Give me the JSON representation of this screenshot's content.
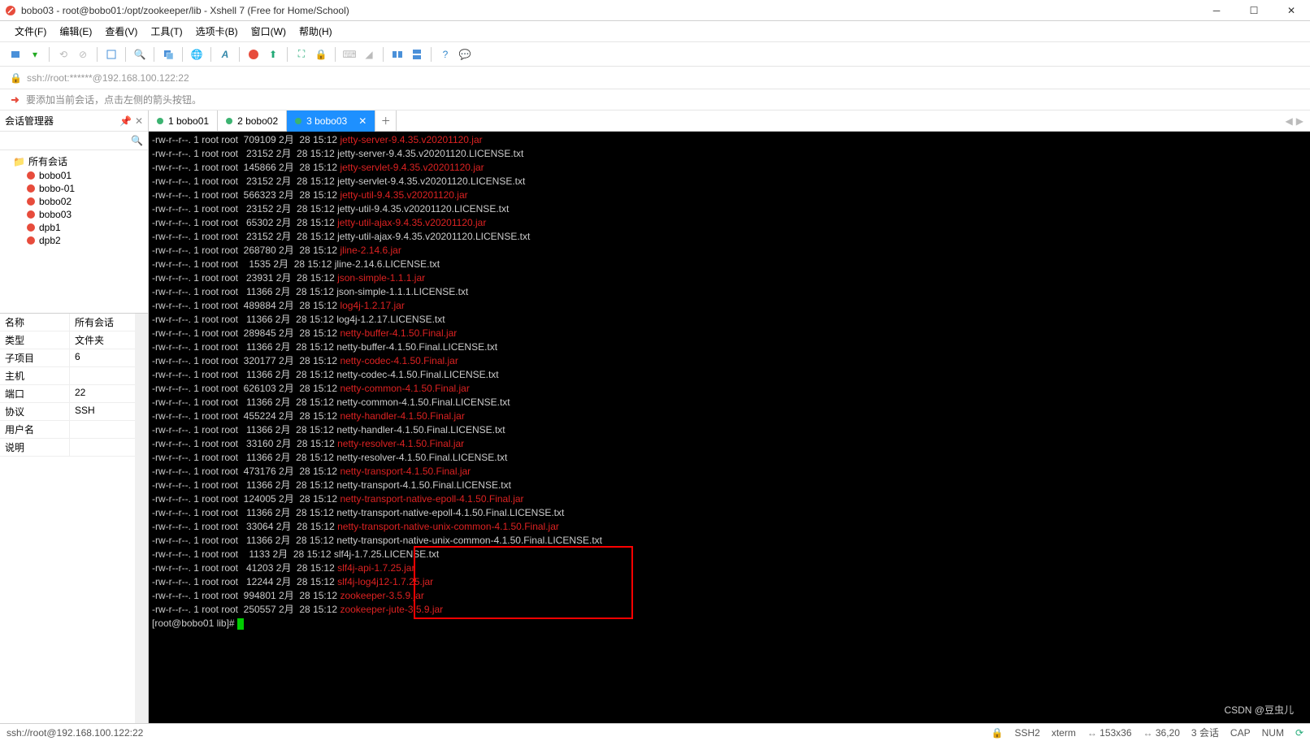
{
  "title": "bobo03 - root@bobo01:/opt/zookeeper/lib - Xshell 7 (Free for Home/School)",
  "menu": [
    "文件(F)",
    "编辑(E)",
    "查看(V)",
    "工具(T)",
    "选项卡(B)",
    "窗口(W)",
    "帮助(H)"
  ],
  "addr": "ssh://root:******@192.168.100.122:22",
  "hint": "要添加当前会话，点击左侧的箭头按钮。",
  "side_title": "会话管理器",
  "tree_root": "所有会话",
  "tree_items": [
    "bobo01",
    "bobo-01",
    "bobo02",
    "bobo03",
    "dpb1",
    "dpb2"
  ],
  "props": [
    {
      "k": "名称",
      "v": "所有会话"
    },
    {
      "k": "类型",
      "v": "文件夹"
    },
    {
      "k": "子项目",
      "v": "6"
    },
    {
      "k": "主机",
      "v": ""
    },
    {
      "k": "端口",
      "v": "22"
    },
    {
      "k": "协议",
      "v": "SSH"
    },
    {
      "k": "用户名",
      "v": ""
    },
    {
      "k": "说明",
      "v": ""
    }
  ],
  "tabs": [
    {
      "n": "1",
      "label": "bobo01",
      "active": false
    },
    {
      "n": "2",
      "label": "bobo02",
      "active": false
    },
    {
      "n": "3",
      "label": "bobo03",
      "active": true
    }
  ],
  "lines": [
    {
      "pre": "-rw-r--r--. 1 root root  709109 2月  28 15:12 ",
      "fn": "jetty-server-9.4.35.v20201120.jar",
      "c": "r"
    },
    {
      "pre": "-rw-r--r--. 1 root root   23152 2月  28 15:12 ",
      "fn": "jetty-server-9.4.35.v20201120.LICENSE.txt",
      "c": "w"
    },
    {
      "pre": "-rw-r--r--. 1 root root  145866 2月  28 15:12 ",
      "fn": "jetty-servlet-9.4.35.v20201120.jar",
      "c": "r"
    },
    {
      "pre": "-rw-r--r--. 1 root root   23152 2月  28 15:12 ",
      "fn": "jetty-servlet-9.4.35.v20201120.LICENSE.txt",
      "c": "w"
    },
    {
      "pre": "-rw-r--r--. 1 root root  566323 2月  28 15:12 ",
      "fn": "jetty-util-9.4.35.v20201120.jar",
      "c": "r"
    },
    {
      "pre": "-rw-r--r--. 1 root root   23152 2月  28 15:12 ",
      "fn": "jetty-util-9.4.35.v20201120.LICENSE.txt",
      "c": "w"
    },
    {
      "pre": "-rw-r--r--. 1 root root   65302 2月  28 15:12 ",
      "fn": "jetty-util-ajax-9.4.35.v20201120.jar",
      "c": "r"
    },
    {
      "pre": "-rw-r--r--. 1 root root   23152 2月  28 15:12 ",
      "fn": "jetty-util-ajax-9.4.35.v20201120.LICENSE.txt",
      "c": "w"
    },
    {
      "pre": "-rw-r--r--. 1 root root  268780 2月  28 15:12 ",
      "fn": "jline-2.14.6.jar",
      "c": "r"
    },
    {
      "pre": "-rw-r--r--. 1 root root    1535 2月  28 15:12 ",
      "fn": "jline-2.14.6.LICENSE.txt",
      "c": "w"
    },
    {
      "pre": "-rw-r--r--. 1 root root   23931 2月  28 15:12 ",
      "fn": "json-simple-1.1.1.jar",
      "c": "r"
    },
    {
      "pre": "-rw-r--r--. 1 root root   11366 2月  28 15:12 ",
      "fn": "json-simple-1.1.1.LICENSE.txt",
      "c": "w"
    },
    {
      "pre": "-rw-r--r--. 1 root root  489884 2月  28 15:12 ",
      "fn": "log4j-1.2.17.jar",
      "c": "r"
    },
    {
      "pre": "-rw-r--r--. 1 root root   11366 2月  28 15:12 ",
      "fn": "log4j-1.2.17.LICENSE.txt",
      "c": "w"
    },
    {
      "pre": "-rw-r--r--. 1 root root  289845 2月  28 15:12 ",
      "fn": "netty-buffer-4.1.50.Final.jar",
      "c": "r"
    },
    {
      "pre": "-rw-r--r--. 1 root root   11366 2月  28 15:12 ",
      "fn": "netty-buffer-4.1.50.Final.LICENSE.txt",
      "c": "w"
    },
    {
      "pre": "-rw-r--r--. 1 root root  320177 2月  28 15:12 ",
      "fn": "netty-codec-4.1.50.Final.jar",
      "c": "r"
    },
    {
      "pre": "-rw-r--r--. 1 root root   11366 2月  28 15:12 ",
      "fn": "netty-codec-4.1.50.Final.LICENSE.txt",
      "c": "w"
    },
    {
      "pre": "-rw-r--r--. 1 root root  626103 2月  28 15:12 ",
      "fn": "netty-common-4.1.50.Final.jar",
      "c": "r"
    },
    {
      "pre": "-rw-r--r--. 1 root root   11366 2月  28 15:12 ",
      "fn": "netty-common-4.1.50.Final.LICENSE.txt",
      "c": "w"
    },
    {
      "pre": "-rw-r--r--. 1 root root  455224 2月  28 15:12 ",
      "fn": "netty-handler-4.1.50.Final.jar",
      "c": "r"
    },
    {
      "pre": "-rw-r--r--. 1 root root   11366 2月  28 15:12 ",
      "fn": "netty-handler-4.1.50.Final.LICENSE.txt",
      "c": "w"
    },
    {
      "pre": "-rw-r--r--. 1 root root   33160 2月  28 15:12 ",
      "fn": "netty-resolver-4.1.50.Final.jar",
      "c": "r"
    },
    {
      "pre": "-rw-r--r--. 1 root root   11366 2月  28 15:12 ",
      "fn": "netty-resolver-4.1.50.Final.LICENSE.txt",
      "c": "w"
    },
    {
      "pre": "-rw-r--r--. 1 root root  473176 2月  28 15:12 ",
      "fn": "netty-transport-4.1.50.Final.jar",
      "c": "r"
    },
    {
      "pre": "-rw-r--r--. 1 root root   11366 2月  28 15:12 ",
      "fn": "netty-transport-4.1.50.Final.LICENSE.txt",
      "c": "w"
    },
    {
      "pre": "-rw-r--r--. 1 root root  124005 2月  28 15:12 ",
      "fn": "netty-transport-native-epoll-4.1.50.Final.jar",
      "c": "r"
    },
    {
      "pre": "-rw-r--r--. 1 root root   11366 2月  28 15:12 ",
      "fn": "netty-transport-native-epoll-4.1.50.Final.LICENSE.txt",
      "c": "w"
    },
    {
      "pre": "-rw-r--r--. 1 root root   33064 2月  28 15:12 ",
      "fn": "netty-transport-native-unix-common-4.1.50.Final.jar",
      "c": "r"
    },
    {
      "pre": "-rw-r--r--. 1 root root   11366 2月  28 15:12 ",
      "fn": "netty-transport-native-unix-common-4.1.50.Final.LICENSE.txt",
      "c": "w"
    },
    {
      "pre": "-rw-r--r--. 1 root root    1133 2月  28 15:12 ",
      "fn": "slf4j-1.7.25.LICENSE.txt",
      "c": "w"
    },
    {
      "pre": "-rw-r--r--. 1 root root   41203 2月  28 15:12 ",
      "fn": "slf4j-api-1.7.25.jar",
      "c": "r"
    },
    {
      "pre": "-rw-r--r--. 1 root root   12244 2月  28 15:12 ",
      "fn": "slf4j-log4j12-1.7.25.jar",
      "c": "r"
    },
    {
      "pre": "-rw-r--r--. 1 root root  994801 2月  28 15:12 ",
      "fn": "zookeeper-3.5.9.jar",
      "c": "r"
    },
    {
      "pre": "-rw-r--r--. 1 root root  250557 2月  28 15:12 ",
      "fn": "zookeeper-jute-3.5.9.jar",
      "c": "r"
    }
  ],
  "prompt": "[root@bobo01 lib]# ",
  "status_left": "ssh://root@192.168.100.122:22",
  "status_right": [
    "SSH2",
    "xterm",
    "153x36",
    "36,20",
    "3 会话",
    "CAP",
    "NUM"
  ],
  "watermark": "CSDN @豆虫儿"
}
